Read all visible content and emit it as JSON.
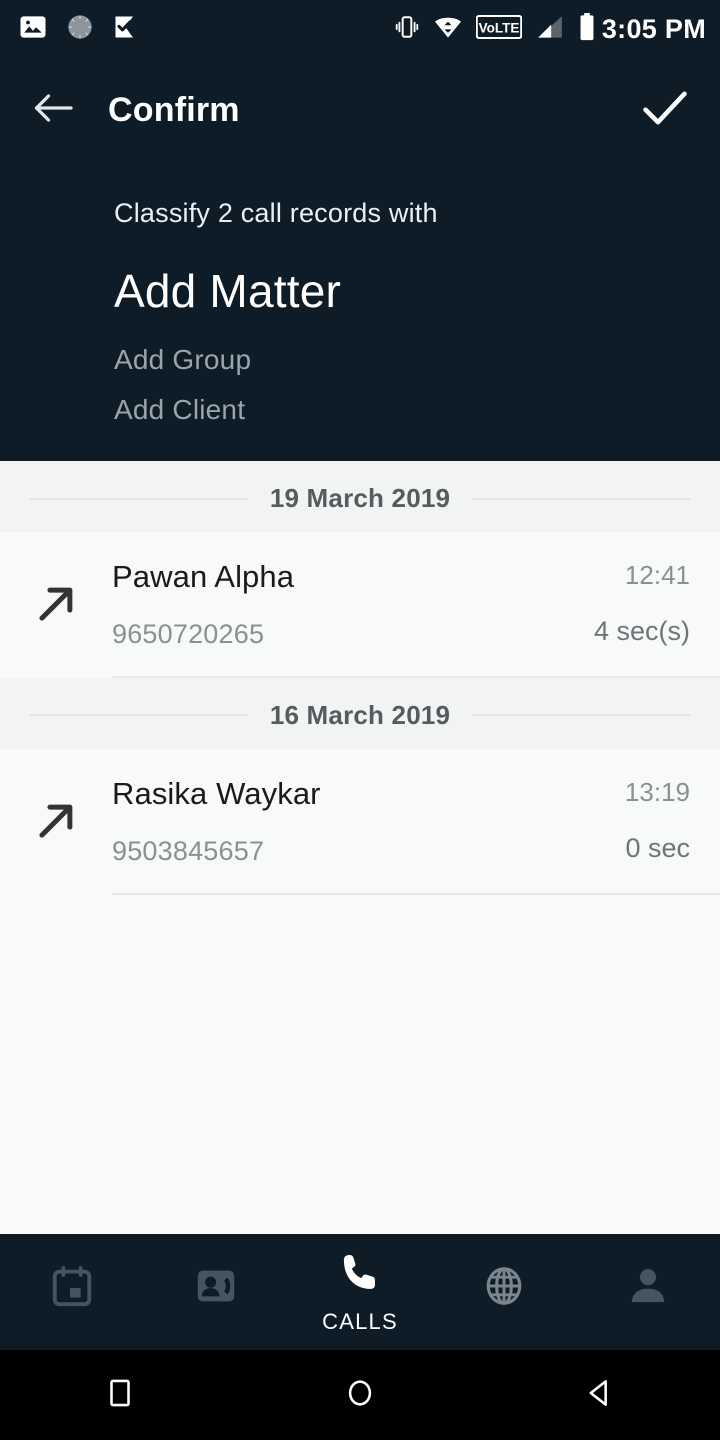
{
  "status_bar": {
    "time": "3:05 PM",
    "left_icons": [
      "image-icon",
      "loading-spinner-icon",
      "checkmark-flag-icon"
    ],
    "right_icons": [
      "vibrate-icon",
      "wifi-icon",
      "volte-icon",
      "signal-icon",
      "battery-icon"
    ],
    "volte_label": "VoLTE"
  },
  "app_bar": {
    "back_label": "back-arrow",
    "title": "Confirm",
    "confirm_label": "check"
  },
  "header": {
    "subtitle": "Classify 2 call records with",
    "selected_option": "Add Matter",
    "options": [
      {
        "label": "Add Group"
      },
      {
        "label": "Add Client"
      }
    ]
  },
  "call_list": {
    "sections": [
      {
        "date": "19 March 2019",
        "calls": [
          {
            "direction_icon": "outgoing-call-arrow",
            "name": "Pawan Alpha",
            "number": "9650720265",
            "time": "12:41",
            "duration": "4 sec(s)"
          }
        ]
      },
      {
        "date": "16 March 2019",
        "calls": [
          {
            "direction_icon": "outgoing-call-arrow",
            "name": "Rasika Waykar",
            "number": "9503845657",
            "time": "13:19",
            "duration": "0 sec"
          }
        ]
      }
    ]
  },
  "bottom_nav": {
    "items": [
      {
        "icon": "calendar-icon",
        "label": "",
        "active": false
      },
      {
        "icon": "contacts-icon",
        "label": "",
        "active": false
      },
      {
        "icon": "phone-icon",
        "label": "CALLS",
        "active": true
      },
      {
        "icon": "globe-icon",
        "label": "",
        "active": false
      },
      {
        "icon": "person-icon",
        "label": "",
        "active": false
      }
    ]
  },
  "system_nav": {
    "buttons": [
      "recents-square-icon",
      "home-circle-icon",
      "back-triangle-icon"
    ]
  },
  "colors": {
    "dark": "#0e1c27",
    "content_bg": "#f8f9f9",
    "date_band": "#f2f3f3",
    "accent_text": "#ffffff",
    "muted": "#9aa4ab"
  }
}
